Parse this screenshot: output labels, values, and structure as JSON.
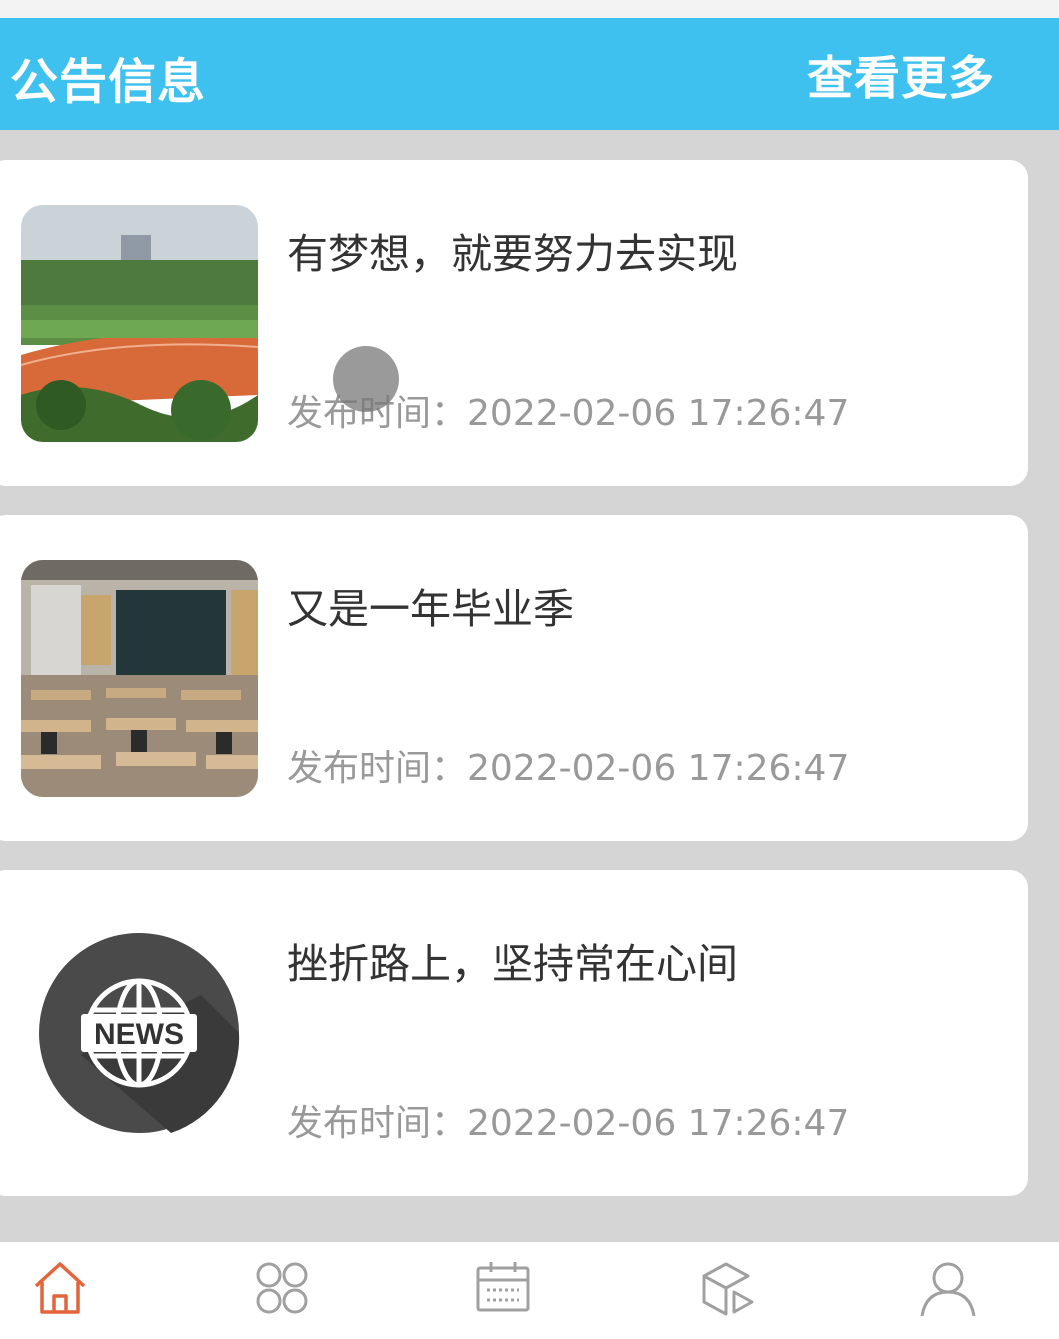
{
  "header": {
    "title": "公告信息",
    "more_label": "查看更多"
  },
  "notices": [
    {
      "title": "有梦想，就要努力去实现",
      "time_label": "发布时间：",
      "time": "2022-02-06 17:26:47",
      "thumbnail": "sports-field-photo"
    },
    {
      "title": "又是一年毕业季",
      "time_label": "发布时间：",
      "time": "2022-02-06 17:26:47",
      "thumbnail": "classroom-photo"
    },
    {
      "title": "挫折路上，坚持常在心间",
      "time_label": "发布时间：",
      "time": "2022-02-06 17:26:47",
      "thumbnail": "news-globe-icon",
      "thumbnail_text": "NEWS"
    }
  ],
  "tabbar": {
    "active_index": 0,
    "items": [
      {
        "icon": "home-icon",
        "label": ""
      },
      {
        "icon": "grid-icon",
        "label": ""
      },
      {
        "icon": "calendar-icon",
        "label": ""
      },
      {
        "icon": "box-icon",
        "label": ""
      },
      {
        "icon": "user-icon",
        "label": ""
      }
    ]
  },
  "colors": {
    "header_bg": "#3ec1ee",
    "active_tab": "#e4643c",
    "inactive_tab": "#999999",
    "page_bg": "#d6d5d6"
  }
}
